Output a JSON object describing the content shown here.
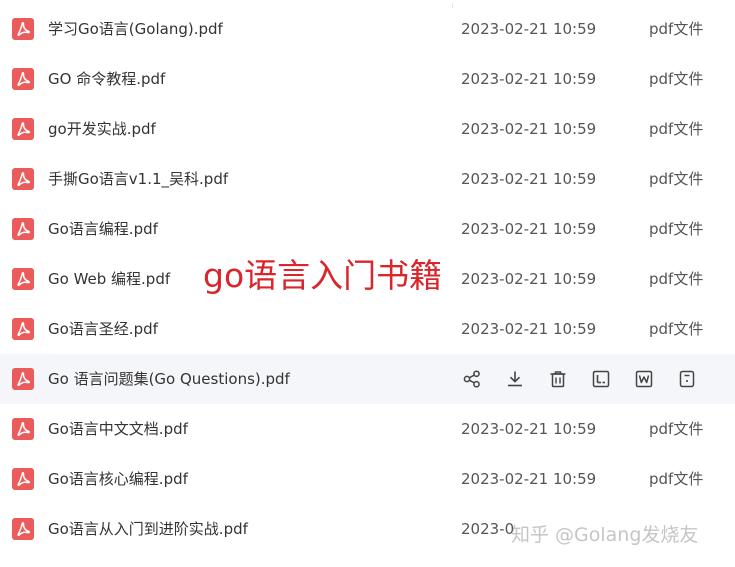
{
  "files": [
    {
      "name": "学习Go语言(Golang).pdf",
      "date": "2023-02-21 10:59",
      "type": "pdf文件"
    },
    {
      "name": "GO 命令教程.pdf",
      "date": "2023-02-21 10:59",
      "type": "pdf文件"
    },
    {
      "name": "go开发实战.pdf",
      "date": "2023-02-21 10:59",
      "type": "pdf文件"
    },
    {
      "name": "手撕Go语言v1.1_吴科.pdf",
      "date": "2023-02-21 10:59",
      "type": "pdf文件"
    },
    {
      "name": "Go语言编程.pdf",
      "date": "2023-02-21 10:59",
      "type": "pdf文件"
    },
    {
      "name": "Go Web 编程.pdf",
      "date": "2023-02-21 10:59",
      "type": "pdf文件"
    },
    {
      "name": "Go语言圣经.pdf",
      "date": "2023-02-21 10:59",
      "type": "pdf文件"
    },
    {
      "name": "Go 语言问题集(Go Questions).pdf",
      "date": "",
      "type": ""
    },
    {
      "name": "Go语言中文文档.pdf",
      "date": "2023-02-21 10:59",
      "type": "pdf文件"
    },
    {
      "name": "Go语言核心编程.pdf",
      "date": "2023-02-21 10:59",
      "type": "pdf文件"
    },
    {
      "name": "Go语言从入门到进阶实战.pdf",
      "date": "2023-0",
      "type": ""
    }
  ],
  "hovered_row_index": 7,
  "row_actions": [
    "share-icon",
    "download-icon",
    "delete-icon",
    "rename-icon",
    "word-convert-icon",
    "copy-icon"
  ],
  "overlay_title": "go语言入门书籍",
  "watermark": "知乎 @Golang发烧友",
  "colors": {
    "pdf_icon": "#ec5b5b",
    "overlay_title": "#d9252b",
    "hover_row_bg": "#f5f6f9",
    "action_icon": "#444444"
  }
}
